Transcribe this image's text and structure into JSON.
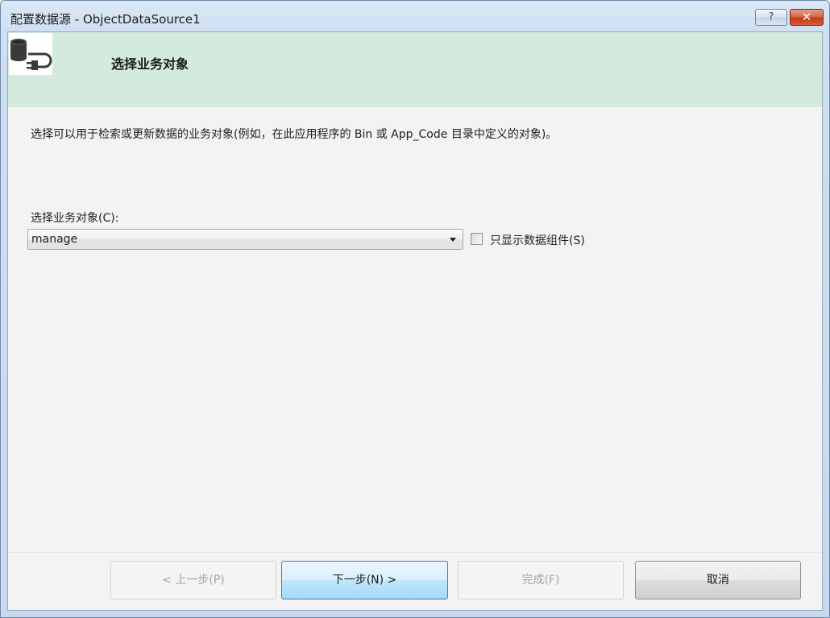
{
  "window": {
    "title": "配置数据源 - ObjectDataSource1",
    "help_glyph": "?",
    "close_glyph": "✕"
  },
  "header": {
    "title": "选择业务对象",
    "icon": "database-connect-icon"
  },
  "main": {
    "description": "选择可以用于检索或更新数据的业务对象(例如，在此应用程序的 Bin 或 App_Code 目录中定义的对象)。",
    "business_object_label": "选择业务对象(C):",
    "business_object_value": "manage",
    "data_components_only_label": "只显示数据组件(S)",
    "data_components_only_checked": false
  },
  "footer": {
    "back_label": "< 上一步(P)",
    "next_label": "下一步(N) >",
    "finish_label": "完成(F)",
    "cancel_label": "取消"
  },
  "colors": {
    "header_bg": "#d3ebdd",
    "client_bg": "#f3f3f3",
    "close_button": "#c2391b",
    "next_button_border": "#3c7fb1"
  }
}
